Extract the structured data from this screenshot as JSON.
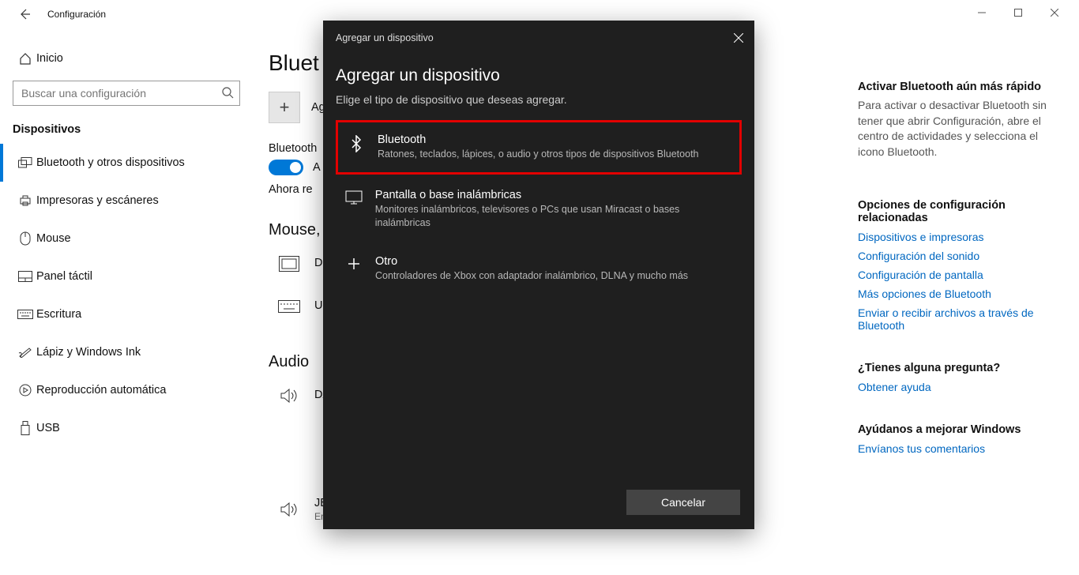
{
  "titlebar": {
    "title": "Configuración"
  },
  "sidebar": {
    "home": "Inicio",
    "search_placeholder": "Buscar una configuración",
    "section": "Dispositivos",
    "items": [
      "Bluetooth y otros dispositivos",
      "Impresoras y escáneres",
      "Mouse",
      "Panel táctil",
      "Escritura",
      "Lápiz y Windows Ink",
      "Reproducción automática",
      "USB"
    ]
  },
  "main": {
    "title_fragment": "Bluet",
    "add_label": "Ag",
    "bt_label": "Bluetooth",
    "toggle_state": "A",
    "discover_line": "Ahora re",
    "group1": "Mouse,",
    "dev1": "De",
    "dev2": "US",
    "group2": "Audio",
    "dev3": "DA",
    "dev4_name": "JBL Xtreme",
    "dev4_status": "Emparejado"
  },
  "right": {
    "h1": "Activar Bluetooth aún más rápido",
    "p1": "Para activar o desactivar Bluetooth sin tener que abrir Configuración, abre el centro de actividades y selecciona el icono Bluetooth.",
    "h2": "Opciones de configuración relacionadas",
    "links": [
      "Dispositivos e impresoras",
      "Configuración del sonido",
      "Configuración de pantalla",
      "Más opciones de Bluetooth",
      "Enviar o recibir archivos a través de Bluetooth"
    ],
    "h3": "¿Tienes alguna pregunta?",
    "link_help": "Obtener ayuda",
    "h4": "Ayúdanos a mejorar Windows",
    "link_feedback": "Envíanos tus comentarios"
  },
  "modal": {
    "header": "Agregar un dispositivo",
    "title": "Agregar un dispositivo",
    "sub": "Elige el tipo de dispositivo que deseas agregar.",
    "opts": [
      {
        "title": "Bluetooth",
        "desc": "Ratones, teclados, lápices, o audio y otros tipos de dispositivos Bluetooth"
      },
      {
        "title": "Pantalla o base inalámbricas",
        "desc": "Monitores inalámbricos, televisores o PCs que usan Miracast o bases inalámbricas"
      },
      {
        "title": "Otro",
        "desc": "Controladores de Xbox con adaptador inalámbrico, DLNA y mucho más"
      }
    ],
    "cancel": "Cancelar"
  }
}
